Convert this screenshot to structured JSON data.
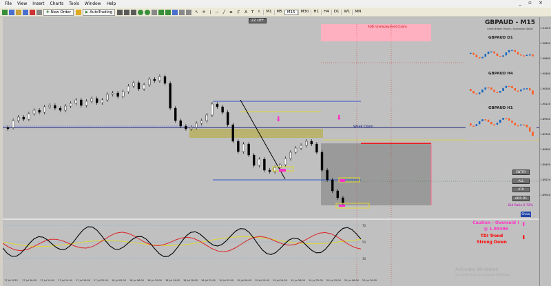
{
  "menu": [
    "File",
    "View",
    "Insert",
    "Charts",
    "Tools",
    "Window",
    "Help"
  ],
  "toolbar": {
    "new_order": "New Order",
    "autotrading": "AutoTrading",
    "timeframes": [
      "M1",
      "M5",
      "M15",
      "M30",
      "H1",
      "H4",
      "D1",
      "W1",
      "MN"
    ],
    "active_timeframe": "M15"
  },
  "chart": {
    "subtitle": "GBPAUD,M15",
    "symbol_title": "GBPAUD - M15",
    "symbol_desc": "Great Britain Pound / Australian Dollar",
    "zz_button": "ZZ OFF",
    "unemployment_label": "AUD: Unemployment Claims",
    "week_open": "Week Open",
    "side_buttons": [
      "ENTRY",
      "ALL",
      "ATR",
      "ADR D1"
    ],
    "bid_ratio": "Bid Ratio 0.72%",
    "show_button": "Show",
    "mini_charts": [
      "GBPAUD D1",
      "GBPAUD H4",
      "GBPAUD H1"
    ],
    "tdi_caution": "Caution - Oversold !",
    "tdi_value": "@ 1.89396",
    "tdi_trend": "TDI Trend",
    "tdi_strong": "Strong Down",
    "tdi_levels": [
      "70",
      "50",
      "30"
    ],
    "watermark": "Activate Windows",
    "watermark_sub": "Go to Settings to activate Windows.",
    "time_labels": [
      "17 Jul 2023",
      "17 Jul 06:00",
      "17 Jul 10:00",
      "17 Jul 14:00",
      "17 Jul 18:00",
      "17 Jul 22:00",
      "18 Jul 02:00",
      "18 Jul 06:00",
      "18 Jul 10:00",
      "18 Jul 14:00",
      "18 Jul 18:00",
      "18 Jul 22:00",
      "19 Jul 02:00",
      "19 Jul 06:00",
      "19 Jul 10:00",
      "19 Jul 14:00",
      "19 Jul 18:00",
      "19 Jul 22:00",
      "20 Jul 02:00",
      "20 Jul 06:00",
      "20 Jul 10:00"
    ],
    "price_labels": [
      "1.91020",
      "1.90840",
      "1.90660",
      "1.90480",
      "1.90300",
      "1.90120",
      "1.89940",
      "1.89760",
      "1.89580",
      "1.89400",
      "1.89220",
      "1.89040"
    ],
    "colors": {
      "bg": "#c0c0c0",
      "bull": "#ffffff",
      "bear": "#000000",
      "sell": "#ff0000",
      "buy": "#2e7d32",
      "pink": "#ff2fc7",
      "navy": "#1a237e",
      "yellow": "#e0d830"
    }
  }
}
